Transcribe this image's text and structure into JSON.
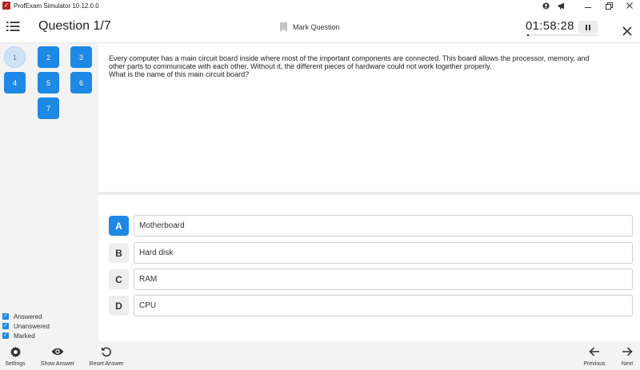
{
  "window": {
    "title": "ProfExam Simulator 10.12.0.0",
    "icons": [
      "user-icon",
      "megaphone-icon"
    ],
    "controls": [
      "minimize-icon",
      "restore-icon",
      "close-icon"
    ]
  },
  "header": {
    "question_title": "Question 1/7",
    "mark_label": "Mark Question",
    "timer": "01:58:28",
    "timer_progress": 0.02
  },
  "sidebar": {
    "questions": [
      "1",
      "2",
      "3",
      "4",
      "5",
      "6",
      "7"
    ],
    "current": "1",
    "legend": [
      {
        "label": "Answered",
        "checked": true
      },
      {
        "label": "Unanswered",
        "checked": true
      },
      {
        "label": "Marked",
        "checked": true
      }
    ]
  },
  "question": {
    "line1": "Every computer has a main circuit board inside where most of the important components are connected. This board allows the processor, memory, and",
    "line2": "other parts to communicate with each other. Without it, the different pieces of hardware could not work together properly.",
    "line3": "What is the name of this main circuit board?"
  },
  "answers": [
    {
      "letter": "A",
      "text": "Motherboard",
      "selected": true
    },
    {
      "letter": "B",
      "text": "Hard disk",
      "selected": false
    },
    {
      "letter": "C",
      "text": "RAM",
      "selected": false
    },
    {
      "letter": "D",
      "text": "CPU",
      "selected": false
    }
  ],
  "bottombar": {
    "settings": "Settings",
    "show_answer": "Show Answer",
    "reset_answer": "Reset Answer",
    "previous": "Previous",
    "next": "Next"
  },
  "colors": {
    "accent": "#1e88e5",
    "brand": "#b3261e"
  }
}
